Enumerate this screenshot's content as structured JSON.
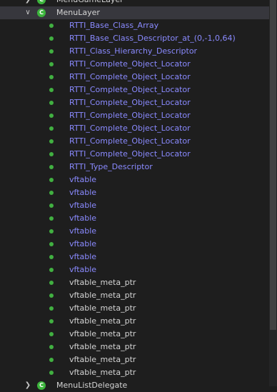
{
  "tree": {
    "parents": {
      "above": {
        "label": "MenuGameLayer",
        "icon": "class-icon",
        "expanded": false
      },
      "current": {
        "label": "MenuLayer",
        "icon": "class-icon",
        "expanded": true
      },
      "below": {
        "label": "MenuListDelegate",
        "icon": "class-icon",
        "expanded": false
      }
    },
    "children": [
      {
        "label": "RTTI_Base_Class_Array",
        "color": "#8a8aff"
      },
      {
        "label": "RTTI_Base_Class_Descriptor_at_(0,-1,0,64)",
        "color": "#8a8aff"
      },
      {
        "label": "RTTI_Class_Hierarchy_Descriptor",
        "color": "#8a8aff"
      },
      {
        "label": "RTTI_Complete_Object_Locator",
        "color": "#8a8aff"
      },
      {
        "label": "RTTI_Complete_Object_Locator",
        "color": "#8a8aff"
      },
      {
        "label": "RTTI_Complete_Object_Locator",
        "color": "#8a8aff"
      },
      {
        "label": "RTTI_Complete_Object_Locator",
        "color": "#8a8aff"
      },
      {
        "label": "RTTI_Complete_Object_Locator",
        "color": "#8a8aff"
      },
      {
        "label": "RTTI_Complete_Object_Locator",
        "color": "#8a8aff"
      },
      {
        "label": "RTTI_Complete_Object_Locator",
        "color": "#8a8aff"
      },
      {
        "label": "RTTI_Complete_Object_Locator",
        "color": "#8a8aff"
      },
      {
        "label": "RTTI_Type_Descriptor",
        "color": "#8a8aff"
      },
      {
        "label": "vftable",
        "color": "#8a8aff"
      },
      {
        "label": "vftable",
        "color": "#8a8aff"
      },
      {
        "label": "vftable",
        "color": "#8a8aff"
      },
      {
        "label": "vftable",
        "color": "#8a8aff"
      },
      {
        "label": "vftable",
        "color": "#8a8aff"
      },
      {
        "label": "vftable",
        "color": "#8a8aff"
      },
      {
        "label": "vftable",
        "color": "#8a8aff"
      },
      {
        "label": "vftable",
        "color": "#8a8aff"
      },
      {
        "label": "vftable_meta_ptr",
        "color": "#d4d4d4"
      },
      {
        "label": "vftable_meta_ptr",
        "color": "#d4d4d4"
      },
      {
        "label": "vftable_meta_ptr",
        "color": "#d4d4d4"
      },
      {
        "label": "vftable_meta_ptr",
        "color": "#d4d4d4"
      },
      {
        "label": "vftable_meta_ptr",
        "color": "#d4d4d4"
      },
      {
        "label": "vftable_meta_ptr",
        "color": "#d4d4d4"
      },
      {
        "label": "vftable_meta_ptr",
        "color": "#d4d4d4"
      },
      {
        "label": "vftable_meta_ptr",
        "color": "#d4d4d4"
      }
    ],
    "child_icon": "green-dot-icon",
    "class_icon_glyph": "C"
  },
  "colors": {
    "background": "#1e1e1e",
    "selected_row": "#37373d",
    "icon_green": "#3cb43c",
    "label_blue": "#8a8aff",
    "label_default": "#d4d4d4"
  }
}
